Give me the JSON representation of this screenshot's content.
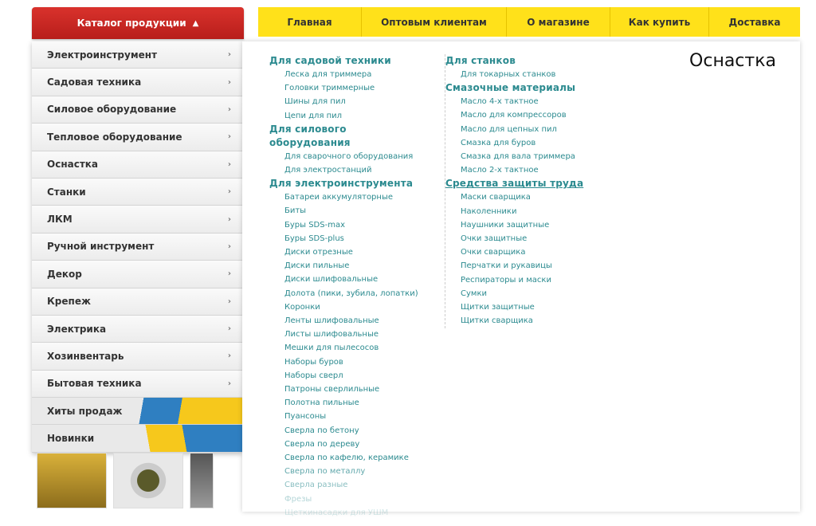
{
  "catalog_button": {
    "label": "Каталог продукции",
    "arrow": "▲"
  },
  "topnav": [
    "Главная",
    "Оптовым клиентам",
    "О магазине",
    "Как купить",
    "Доставка"
  ],
  "sidebar": [
    "Электроинструмент",
    "Садовая техника",
    "Силовое оборудование",
    "Тепловое оборудование",
    "Оснастка",
    "Станки",
    "ЛКМ",
    "Ручной инструмент",
    "Декор",
    "Крепеж",
    "Электрика",
    "Хозинвентарь",
    "Бытовая техника"
  ],
  "sidebar_promos": [
    "Хиты продаж",
    "Новинки"
  ],
  "chevron": "›",
  "panel": {
    "title": "Оснастка",
    "col1": [
      {
        "title": "Для садовой техники",
        "links": [
          "Леска для триммера",
          "Головки триммерные",
          "Шины для пил",
          "Цепи для пил"
        ]
      },
      {
        "title": "Для силового оборудования",
        "links": [
          "Для сварочного оборудования",
          "Для электростанций"
        ]
      },
      {
        "title": "Для электроинструмента",
        "links": [
          "Батареи аккумуляторные",
          "Биты",
          "Буры SDS-max",
          "Буры SDS-plus",
          "Диски отрезные",
          "Диски пильные",
          "Диски шлифовальные",
          "Долота (пики, зубила, лопатки)",
          "Коронки",
          "Ленты шлифовальные",
          "Листы шлифовальные",
          "Мешки для пылесосов",
          "Наборы буров",
          "Наборы сверл",
          "Патроны сверлильные",
          "Полотна пильные",
          "Пуансоны",
          "Сверла по бетону",
          "Сверла по дереву",
          "Сверла по кафелю, керамике",
          "Сверла по металлу",
          "Сверла разные",
          "Фрезы",
          "Щеткинасадки для УШМ"
        ]
      }
    ],
    "col2": [
      {
        "title": "Для станков",
        "links": [
          "Для токарных станков"
        ]
      },
      {
        "title": "Смазочные материалы",
        "links": [
          "Масло 4-х тактное",
          "Масло для компрессоров",
          "Масло для цепных пил",
          "Смазка для буров",
          "Смазка для вала триммера",
          "Масло 2-х тактное"
        ]
      },
      {
        "title": "Средства защиты труда",
        "links": [
          "Маски сварщика",
          "Наколенники",
          "Наушники защитные",
          "Очки защитные",
          "Очки сварщика",
          "Перчатки и рукавицы",
          "Респираторы и маски",
          "Сумки",
          "Щитки защитные",
          "Щитки сварщика"
        ]
      }
    ]
  }
}
